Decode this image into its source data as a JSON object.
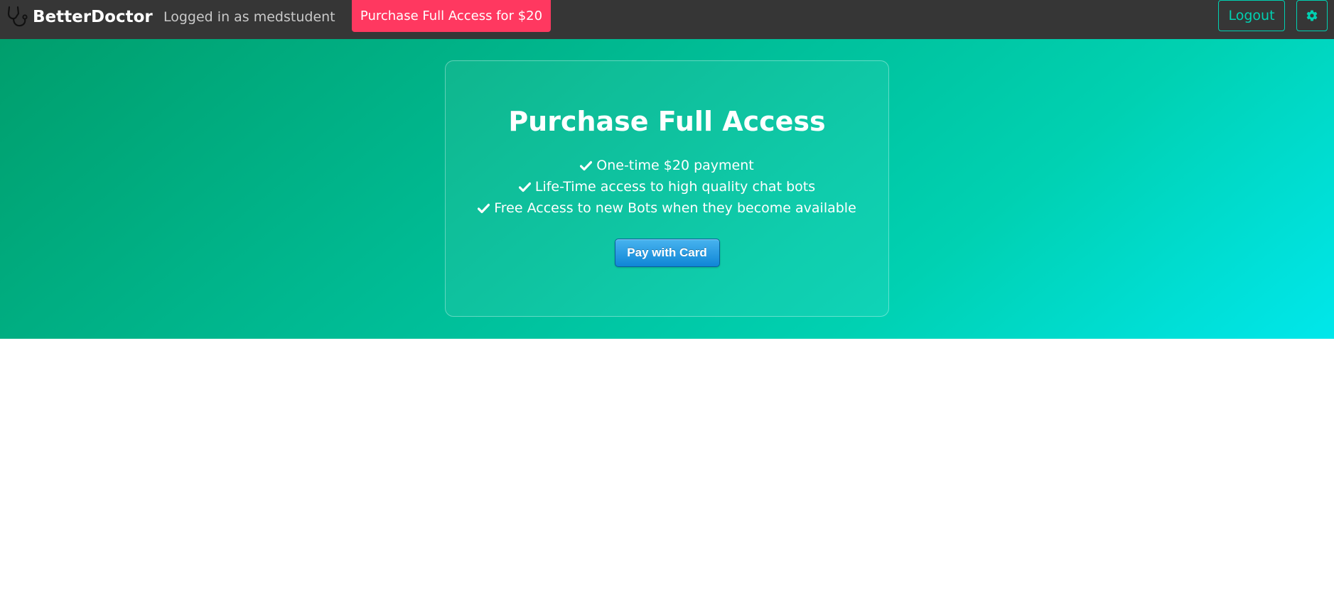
{
  "navbar": {
    "brand": {
      "name": "BetterDoctor",
      "icon": "stethoscope-icon"
    },
    "logged_in_text": "Logged in as medstudent",
    "purchase_button": "Purchase Full Access for $20",
    "logout_button": "Logout",
    "settings_icon": "gear-icon"
  },
  "purchase_card": {
    "title": "Purchase Full Access",
    "features": [
      "One-time $20 payment",
      "Life-Time access to high quality chat bots",
      "Free Access to new Bots when they become available"
    ],
    "feature_icon": "check-icon",
    "pay_button": "Pay with Card"
  },
  "colors": {
    "navbar_bg": "#363636",
    "danger": "#ff3860",
    "accent": "#00d1b2",
    "hero_gradient": [
      "#009e6c",
      "#00d1b2",
      "#00e7eb"
    ],
    "pay_button": "#1a8fdc"
  }
}
